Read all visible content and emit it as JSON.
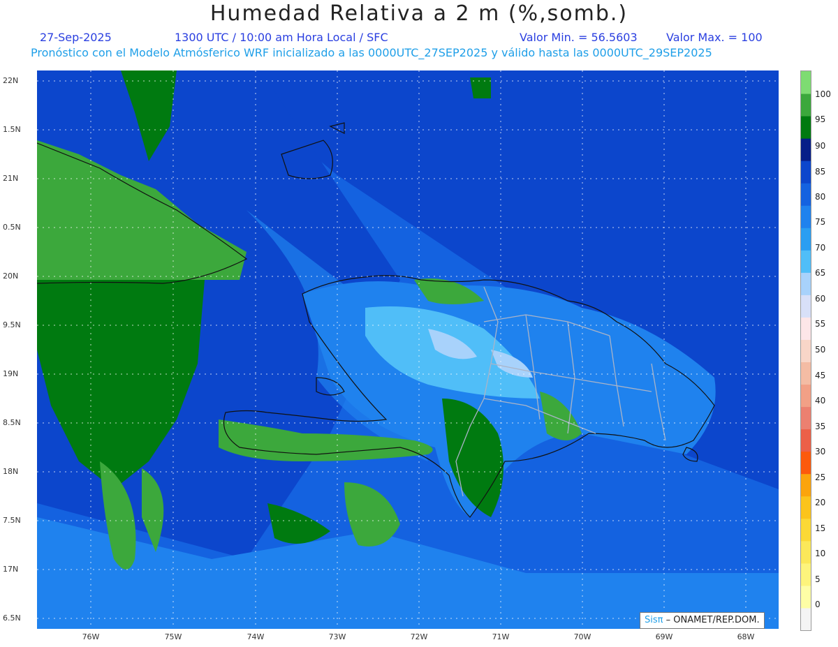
{
  "header": {
    "title": "Humedad Relativa a 2 m (%,somb.)",
    "date": "27-Sep-2025",
    "time": "1300 UTC / 10:00 am Hora Local / SFC",
    "min": "Valor Min. = 56.5603",
    "max": "Valor Max. = 100",
    "model": "Pronóstico con el Modelo Atmósferico WRF inicializado a las 0000UTC_27SEP2025 y válido hasta las  0000UTC_29SEP2025"
  },
  "axes": {
    "lat_labels": [
      "22N",
      "1.5N",
      "21N",
      "0.5N",
      "20N",
      "9.5N",
      "19N",
      "8.5N",
      "18N",
      "7.5N",
      "17N",
      "6.5N"
    ],
    "lon_labels": [
      "76W",
      "75W",
      "74W",
      "73W",
      "72W",
      "71W",
      "70W",
      "69W",
      "68W"
    ],
    "lat_range": [
      16.5,
      22.0
    ],
    "lon_range": [
      -76.65,
      -67.65
    ]
  },
  "colorbar": {
    "labels": [
      "100",
      "95",
      "90",
      "85",
      "80",
      "75",
      "70",
      "65",
      "60",
      "55",
      "50",
      "45",
      "40",
      "35",
      "30",
      "25",
      "20",
      "15",
      "10",
      "5",
      "0"
    ],
    "colors": [
      "#f4f4f4",
      "#fefea6",
      "#fdf47c",
      "#fbe85a",
      "#fbd936",
      "#fbc41c",
      "#fba40c",
      "#fc5a0c",
      "#ec6048",
      "#ec8070",
      "#f2a086",
      "#f4bca4",
      "#f8d6c8",
      "#fde6e8",
      "#d8e0f8",
      "#a8d2fb",
      "#50bef8",
      "#2a9ef2",
      "#1f82ee",
      "#1462e0",
      "#0c46cc",
      "#061e88",
      "#007a10",
      "#3ca83c",
      "#7edc72"
    ]
  },
  "credit": {
    "sis": "Sisπ",
    "org": "– ONAMET/REP.DOM."
  }
}
